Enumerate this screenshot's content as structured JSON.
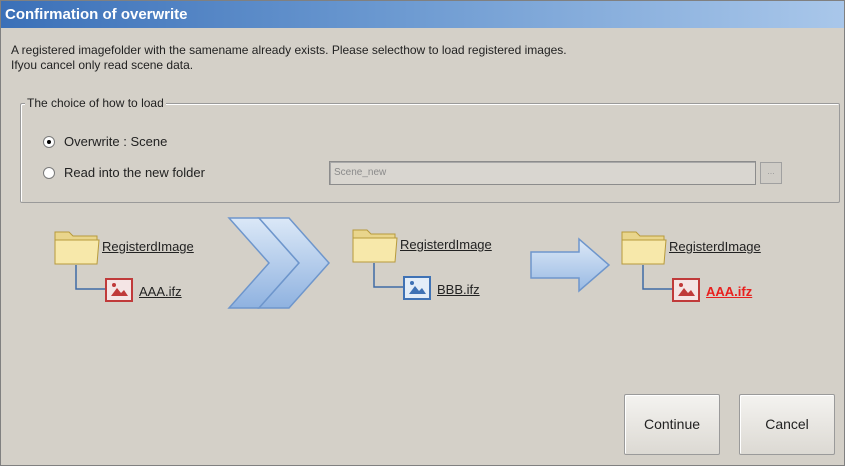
{
  "window": {
    "title": "Confirmation of overwrite"
  },
  "message": {
    "line1": "A registered imagefolder with the samename already exists. Please selecthow to load registered images.",
    "line2": "Ifyou cancel only read scene data."
  },
  "load_choice": {
    "legend": "The choice of how to load",
    "options": [
      {
        "label": "Overwrite : Scene",
        "selected": true
      },
      {
        "label": "Read into the new folder",
        "selected": false
      }
    ],
    "new_folder_name": "Scene_new",
    "browse_label": "..."
  },
  "diagram": {
    "steps": [
      {
        "folder": "RegisterdImage",
        "file": "AAA.ifz"
      },
      {
        "folder": "RegisterdImage",
        "file": "BBB.ifz"
      },
      {
        "folder": "RegisterdImage",
        "file": "AAA.ifz"
      }
    ]
  },
  "buttons": {
    "continue": "Continue",
    "cancel": "Cancel"
  },
  "colors": {
    "title_bar": "#3b70b8",
    "result_file": "#e8201e",
    "arrow": "#9dbde6"
  }
}
